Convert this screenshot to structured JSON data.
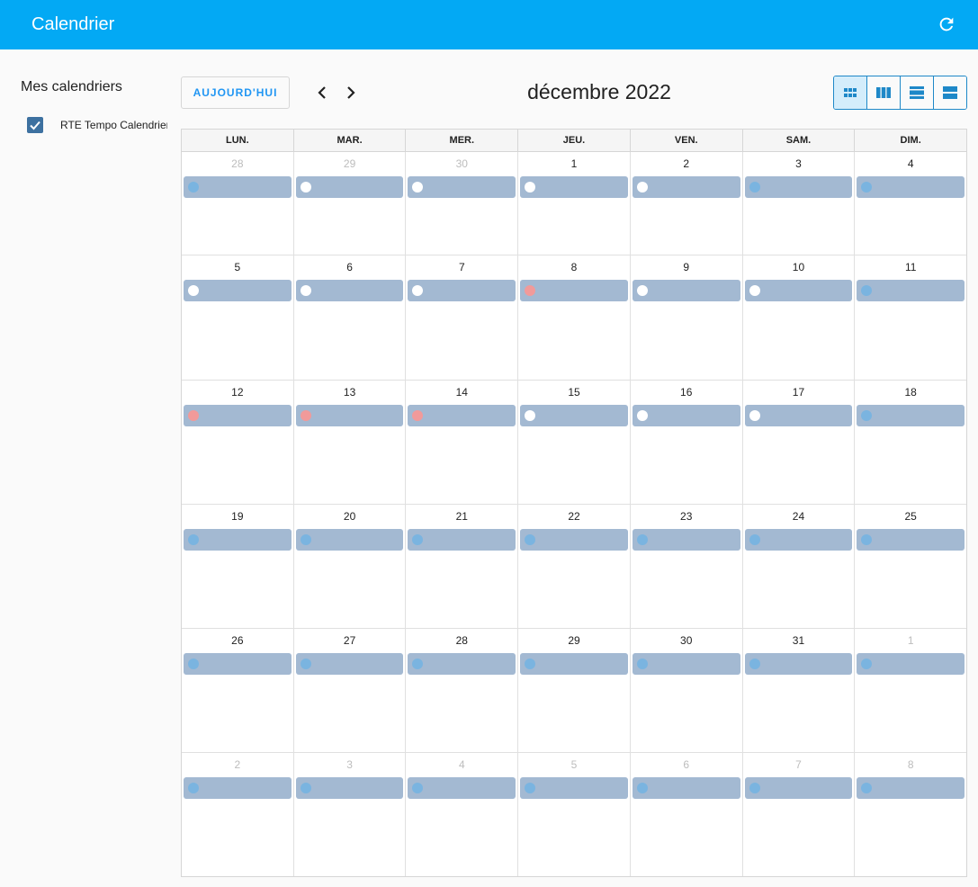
{
  "app": {
    "title": "Calendrier"
  },
  "sidebar": {
    "heading": "Mes calendriers",
    "calendars": [
      {
        "label": "RTE Tempo Calendrier",
        "checked": true,
        "color": "#3d71a0"
      }
    ]
  },
  "toolbar": {
    "today_label": "AUJOURD'HUI",
    "month_title": "décembre 2022",
    "views": [
      {
        "icon": "month-grid-icon",
        "active": true
      },
      {
        "icon": "week-columns-icon",
        "active": false
      },
      {
        "icon": "day-rows-icon",
        "active": false
      },
      {
        "icon": "list-rows-icon",
        "active": false
      }
    ]
  },
  "colors": {
    "accent": "#03a9f4",
    "event_bg": "#a3b9d2",
    "blue_day": "#7ab4e0",
    "white_day": "#ffffff",
    "red_day": "#f19a9a"
  },
  "calendar": {
    "weekdays": [
      "LUN.",
      "MAR.",
      "MER.",
      "JEU.",
      "VEN.",
      "SAM.",
      "DIM."
    ],
    "weeks": [
      [
        {
          "day": "28",
          "other": true,
          "event": "blue"
        },
        {
          "day": "29",
          "other": true,
          "event": "white"
        },
        {
          "day": "30",
          "other": true,
          "event": "white"
        },
        {
          "day": "1",
          "other": false,
          "event": "white"
        },
        {
          "day": "2",
          "other": false,
          "event": "white"
        },
        {
          "day": "3",
          "other": false,
          "event": "blue"
        },
        {
          "day": "4",
          "other": false,
          "event": "blue"
        }
      ],
      [
        {
          "day": "5",
          "other": false,
          "event": "white"
        },
        {
          "day": "6",
          "other": false,
          "event": "white"
        },
        {
          "day": "7",
          "other": false,
          "event": "white"
        },
        {
          "day": "8",
          "other": false,
          "event": "red"
        },
        {
          "day": "9",
          "other": false,
          "event": "white"
        },
        {
          "day": "10",
          "other": false,
          "event": "white"
        },
        {
          "day": "11",
          "other": false,
          "event": "blue"
        }
      ],
      [
        {
          "day": "12",
          "other": false,
          "event": "red"
        },
        {
          "day": "13",
          "other": false,
          "event": "red"
        },
        {
          "day": "14",
          "other": false,
          "event": "red"
        },
        {
          "day": "15",
          "other": false,
          "event": "white"
        },
        {
          "day": "16",
          "other": false,
          "event": "white"
        },
        {
          "day": "17",
          "other": false,
          "event": "white"
        },
        {
          "day": "18",
          "other": false,
          "event": "blue"
        }
      ],
      [
        {
          "day": "19",
          "other": false,
          "event": "blue"
        },
        {
          "day": "20",
          "other": false,
          "event": "blue"
        },
        {
          "day": "21",
          "other": false,
          "event": "blue"
        },
        {
          "day": "22",
          "other": false,
          "event": "blue"
        },
        {
          "day": "23",
          "other": false,
          "event": "blue"
        },
        {
          "day": "24",
          "other": false,
          "event": "blue"
        },
        {
          "day": "25",
          "other": false,
          "event": "blue"
        }
      ],
      [
        {
          "day": "26",
          "other": false,
          "event": "blue"
        },
        {
          "day": "27",
          "other": false,
          "event": "blue"
        },
        {
          "day": "28",
          "other": false,
          "event": "blue"
        },
        {
          "day": "29",
          "other": false,
          "event": "blue"
        },
        {
          "day": "30",
          "other": false,
          "event": "blue"
        },
        {
          "day": "31",
          "other": false,
          "event": "blue"
        },
        {
          "day": "1",
          "other": true,
          "event": "blue"
        }
      ],
      [
        {
          "day": "2",
          "other": true,
          "event": "blue"
        },
        {
          "day": "3",
          "other": true,
          "event": "blue"
        },
        {
          "day": "4",
          "other": true,
          "event": "blue"
        },
        {
          "day": "5",
          "other": true,
          "event": "blue"
        },
        {
          "day": "6",
          "other": true,
          "event": "blue"
        },
        {
          "day": "7",
          "other": true,
          "event": "blue"
        },
        {
          "day": "8",
          "other": true,
          "event": "blue"
        }
      ]
    ]
  }
}
